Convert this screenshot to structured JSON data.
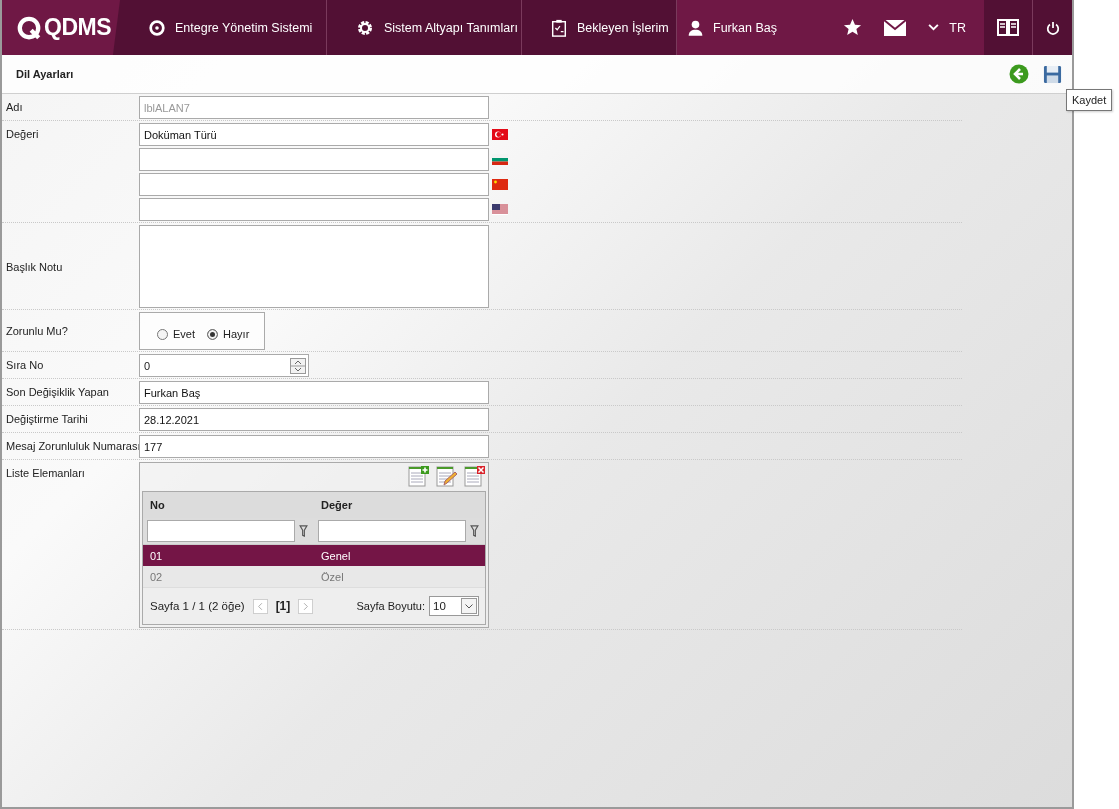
{
  "header": {
    "logo": "QDMS",
    "nav": [
      {
        "label": "Entegre Yönetim Sistemi",
        "selected": false
      },
      {
        "label": "Sistem Altyapı Tanımları",
        "selected": false
      },
      {
        "label": "Bekleyen İşlerim",
        "selected": false
      },
      {
        "label": "Furkan Baş",
        "selected": true
      }
    ],
    "language": "TR"
  },
  "page": {
    "title": "Dil Ayarları",
    "tooltip": "Kaydet"
  },
  "fields": [
    {
      "kind": "text",
      "label": "Adı",
      "value": "lblALAN7",
      "disabled": true
    },
    {
      "kind": "multilang",
      "label": "Değeri",
      "value": "Doküman Türü"
    },
    {
      "kind": "textarea",
      "label": "Başlık Notu"
    },
    {
      "kind": "radio",
      "label": "Zorunlu Mu?",
      "options": [
        {
          "label": "Evet",
          "selected": false
        },
        {
          "label": "Hayır",
          "selected": true
        }
      ]
    },
    {
      "kind": "spinner",
      "label": "Sıra No",
      "value": "0"
    },
    {
      "kind": "text",
      "label": "Son Değişiklik Yapan",
      "value": "Furkan Baş",
      "disabled": false
    },
    {
      "kind": "text",
      "label": "Değiştirme Tarihi",
      "value": "28.12.2021",
      "disabled": false
    },
    {
      "kind": "text",
      "label": "Mesaj Zorunluluk Numarası",
      "value": "177",
      "disabled": false
    },
    {
      "kind": "grid",
      "label": "Liste Elemanları",
      "columns": [
        "No",
        "Değer"
      ],
      "rows": [
        {
          "cells": [
            "01",
            "Genel"
          ],
          "selected": true
        },
        {
          "cells": [
            "02",
            "Özel"
          ],
          "selected": false
        }
      ],
      "pager": {
        "summary": "Sayfa 1 / 1 (2 öğe)",
        "current": "[1]",
        "size_label": "Sayfa Boyutu:",
        "size": "10"
      }
    }
  ]
}
